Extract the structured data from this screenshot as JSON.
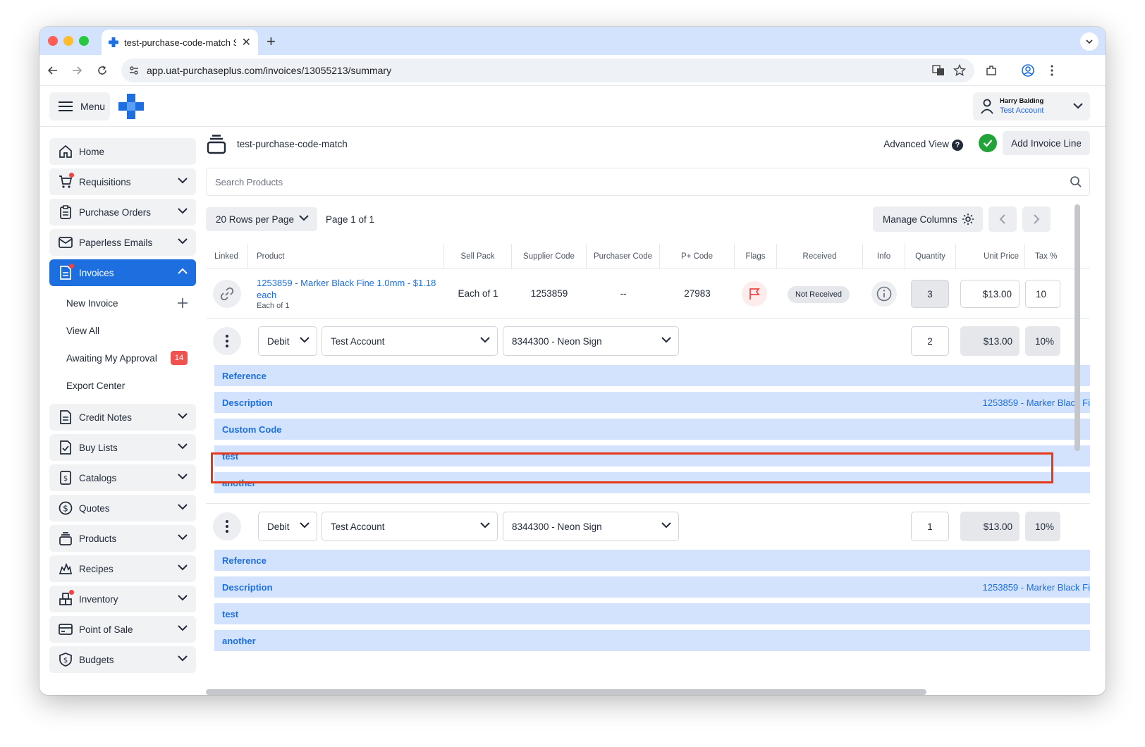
{
  "browser": {
    "tab_title": "test-purchase-code-match S",
    "url": "app.uat-purchaseplus.com/invoices/13055213/summary"
  },
  "header": {
    "menu_label": "Menu",
    "user_name": "Harry Balding",
    "user_account": "Test Account"
  },
  "sidebar": {
    "items": [
      {
        "label": "Home",
        "icon": "home-icon"
      },
      {
        "label": "Requisitions",
        "icon": "cart-icon"
      },
      {
        "label": "Purchase Orders",
        "icon": "clipboard-icon"
      },
      {
        "label": "Paperless Emails",
        "icon": "mail-icon"
      },
      {
        "label": "Invoices",
        "icon": "invoice-icon"
      },
      {
        "label": "Credit Notes",
        "icon": "document-icon"
      },
      {
        "label": "Buy Lists",
        "icon": "checklist-icon"
      },
      {
        "label": "Catalogs",
        "icon": "catalog-icon"
      },
      {
        "label": "Quotes",
        "icon": "dollar-icon"
      },
      {
        "label": "Products",
        "icon": "stack-icon"
      },
      {
        "label": "Recipes",
        "icon": "flame-icon"
      },
      {
        "label": "Inventory",
        "icon": "boxes-icon"
      },
      {
        "label": "Point of Sale",
        "icon": "card-icon"
      },
      {
        "label": "Budgets",
        "icon": "shield-dollar-icon"
      }
    ],
    "invoice_sub": {
      "new_invoice": "New Invoice",
      "view_all": "View All",
      "awaiting": "Awaiting My Approval",
      "awaiting_count": "14",
      "export": "Export Center"
    }
  },
  "page": {
    "title": "test-purchase-code-match",
    "advanced_view": "Advanced View",
    "help": "?",
    "add_invoice_line": "Add Invoice Line",
    "search_placeholder": "Search Products",
    "rows_per_page": "20 Rows per Page",
    "page_of": "Page 1 of 1",
    "manage_columns": "Manage Columns"
  },
  "table": {
    "columns": [
      "Linked",
      "Product",
      "Sell Pack",
      "Supplier Code",
      "Purchaser Code",
      "P+ Code",
      "Flags",
      "Received",
      "Info",
      "Quantity",
      "Unit Price",
      "Tax %"
    ],
    "row": {
      "product_name": "1253859 - Marker Black Fine 1.0mm - $1.18 each",
      "product_sub": "Each of 1",
      "sell_pack": "Each of 1",
      "supplier_code": "1253859",
      "purchaser_code": "--",
      "p_code": "27983",
      "received": "Not Received",
      "quantity": "3",
      "unit_price": "$13.00",
      "tax": "10"
    },
    "lines": [
      {
        "type": "Debit",
        "account": "Test Account",
        "code": "8344300 - Neon Sign",
        "quantity": "2",
        "unit_price": "$13.00",
        "tax": "10%",
        "bars": {
          "reference": "Reference",
          "description": "Description",
          "description_value": "1253859 - Marker Black Fi",
          "custom_code": "Custom Code",
          "test": "test",
          "another": "another"
        }
      },
      {
        "type": "Debit",
        "account": "Test Account",
        "code": "8344300 - Neon Sign",
        "quantity": "1",
        "unit_price": "$13.00",
        "tax": "10%",
        "bars": {
          "reference": "Reference",
          "description": "Description",
          "description_value": "1253859 - Marker Black Fi",
          "test": "test",
          "another": "another"
        }
      }
    ]
  },
  "colors": {
    "accent": "#1d6fe0",
    "bar_bg": "#d3e3fd",
    "highlight": "#e8381a",
    "success": "#22a339"
  }
}
